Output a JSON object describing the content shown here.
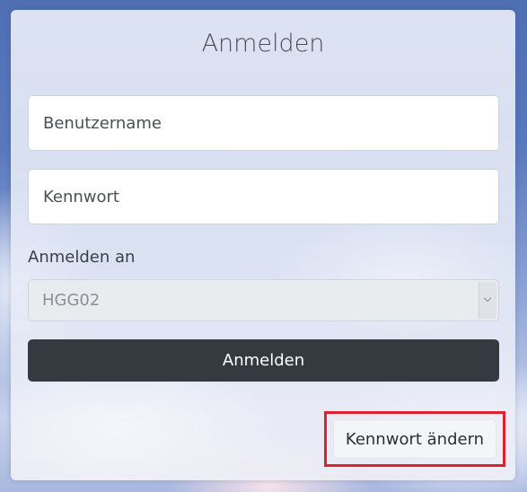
{
  "login_form": {
    "title": "Anmelden",
    "username_placeholder": "Benutzername",
    "password_placeholder": "Kennwort",
    "domain_label": "Anmelden an",
    "domain_value": "HGG02",
    "submit_label": "Anmelden",
    "change_password_label": "Kennwort ändern"
  },
  "colors": {
    "submit_button": "#343a40",
    "highlight_frame": "#e0202a"
  }
}
